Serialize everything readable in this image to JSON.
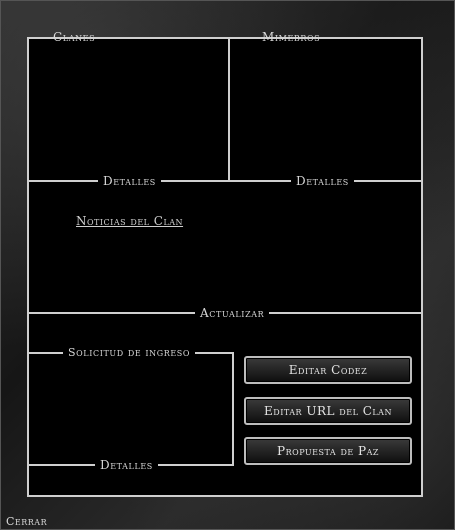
{
  "panels": {
    "clanes_title": "Clanes",
    "miembros_title": "Mimebros",
    "clanes_details": "Detalles",
    "miembros_details": "Detalles",
    "news_link": "Noticias del Clan",
    "update_label": "Actualizar",
    "requests_title": "Solicitud de ingreso",
    "requests_details": "Detalles"
  },
  "buttons": {
    "edit_codex": "Editar Codez",
    "edit_url": "Editar URL del Clan",
    "peace_proposal": "Propuesta de Paz"
  },
  "footer": {
    "close_label": "Cerrar"
  }
}
